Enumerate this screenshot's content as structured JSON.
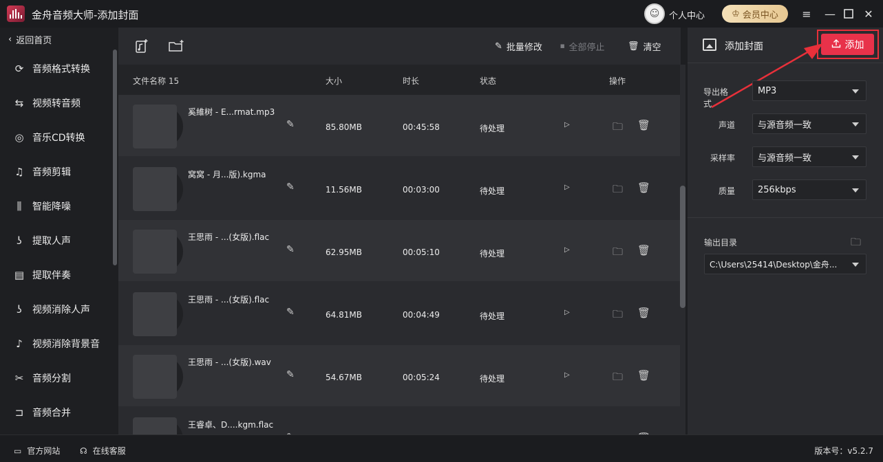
{
  "window": {
    "title": "金舟音频大师-添加封面",
    "user_center": "个人中心",
    "vip_center": "会员中心"
  },
  "sidebar": {
    "back": "返回首页",
    "items": [
      {
        "label": "音频格式转换",
        "icon": "audio-format-icon"
      },
      {
        "label": "视频转音频",
        "icon": "video-to-audio-icon"
      },
      {
        "label": "音乐CD转换",
        "icon": "music-cd-icon"
      },
      {
        "label": "音频剪辑",
        "icon": "audio-cut-icon"
      },
      {
        "label": "智能降噪",
        "icon": "denoise-icon"
      },
      {
        "label": "提取人声",
        "icon": "extract-vocal-icon"
      },
      {
        "label": "提取伴奏",
        "icon": "extract-accompaniment-icon"
      },
      {
        "label": "视频消除人声",
        "icon": "video-remove-vocal-icon"
      },
      {
        "label": "视频消除背景音",
        "icon": "video-remove-bg-icon"
      },
      {
        "label": "音频分割",
        "icon": "audio-split-icon"
      },
      {
        "label": "音频合并",
        "icon": "audio-merge-icon"
      }
    ]
  },
  "toolbar": {
    "batch_edit": "批量修改",
    "stop_all": "全部停止",
    "clear": "清空"
  },
  "table": {
    "headers": {
      "name": "文件名称 15",
      "size": "大小",
      "duration": "时长",
      "status": "状态",
      "actions": "操作"
    },
    "rows": [
      {
        "name": "奚維树 - E...rmat.mp3",
        "size": "85.80MB",
        "duration": "00:45:58",
        "status": "待处理"
      },
      {
        "name": "窝窝 - 月...版).kgma",
        "size": "11.56MB",
        "duration": "00:03:00",
        "status": "待处理"
      },
      {
        "name": "王思雨 - ...(女版).flac",
        "size": "62.95MB",
        "duration": "00:05:10",
        "status": "待处理"
      },
      {
        "name": "王思雨 - ...(女版).flac",
        "size": "64.81MB",
        "duration": "00:04:49",
        "status": "待处理"
      },
      {
        "name": "王思雨 - ...(女版).wav",
        "size": "54.67MB",
        "duration": "00:05:24",
        "status": "待处理"
      },
      {
        "name": "王睿卓、D....kgm.flac",
        "size": "",
        "duration": "",
        "status": ""
      }
    ]
  },
  "right_panel": {
    "title": "添加封面",
    "add_button": "添加",
    "format_label": "导出格式",
    "format_value": "MP3",
    "channel_label": "声道",
    "channel_value": "与源音频一致",
    "samplerate_label": "采样率",
    "samplerate_value": "与源音频一致",
    "quality_label": "质量",
    "quality_value": "256kbps",
    "output_label": "输出目录",
    "output_value": "C:\\Users\\25414\\Desktop\\金舟..."
  },
  "footer": {
    "website": "官方网站",
    "support": "在线客服",
    "version": "版本号：v5.2.7"
  },
  "colors": {
    "accent": "#e8324a",
    "background": "#2a2b2f",
    "sidebar": "#1e1f22"
  }
}
